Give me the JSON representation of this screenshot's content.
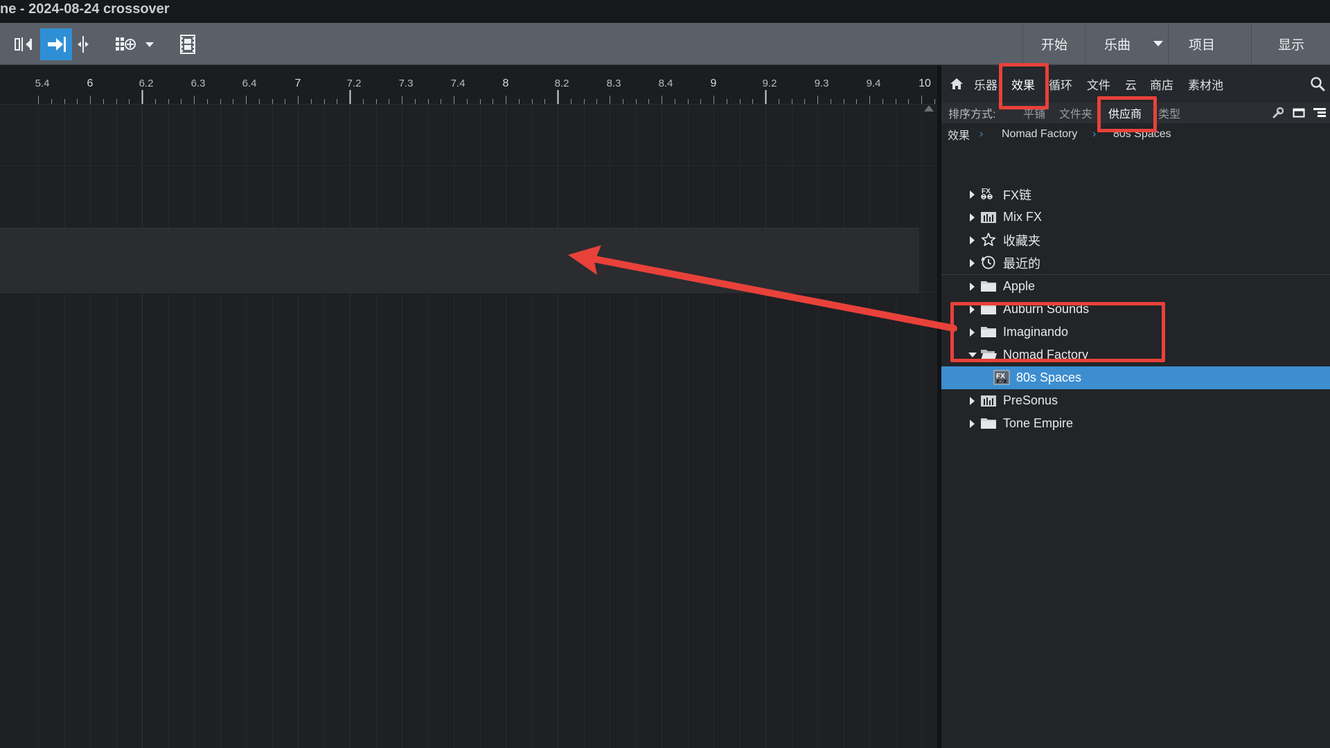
{
  "window": {
    "title": "ne - 2024-08-24 crossover"
  },
  "toolbar": {
    "nav": [
      {
        "label": "开始"
      },
      {
        "label": "乐曲"
      },
      {
        "label": "项目"
      },
      {
        "label": "显示"
      }
    ]
  },
  "ruler": {
    "labels": [
      "5.4",
      "6",
      "6.2",
      "6.3",
      "6.4",
      "7",
      "7.2",
      "7.3",
      "7.4",
      "8",
      "8.2",
      "8.3",
      "8.4",
      "9",
      "9.2",
      "9.3",
      "9.4",
      "10"
    ]
  },
  "browser": {
    "tabs": [
      "乐器",
      "效果",
      "循环",
      "文件",
      "云",
      "商店",
      "素材池"
    ],
    "active_tab": "效果",
    "sort": {
      "label": "排序方式:",
      "options": [
        "平铺",
        "文件夹",
        "供应商",
        "类型"
      ],
      "active": "供应商"
    },
    "breadcrumb": [
      "效果",
      "Nomad Factory",
      "80s Spaces"
    ],
    "tree": [
      {
        "label": "FX链",
        "icon": "fx-chain-icon"
      },
      {
        "label": "Mix FX",
        "icon": "mix-fx-icon"
      },
      {
        "label": "收藏夹",
        "icon": "star-icon"
      },
      {
        "label": "最近的",
        "icon": "clock-icon"
      },
      {
        "label": "Apple",
        "icon": "folder-icon"
      },
      {
        "label": "Auburn Sounds",
        "icon": "folder-icon"
      },
      {
        "label": "Imaginando",
        "icon": "folder-icon"
      },
      {
        "label": "Nomad Factory",
        "icon": "folder-open-icon",
        "expanded": true
      },
      {
        "label": "80s Spaces",
        "icon": "fx-plugin-icon",
        "selected": true,
        "badge": "FX"
      },
      {
        "label": "PreSonus",
        "icon": "mix-fx-icon"
      },
      {
        "label": "Tone Empire",
        "icon": "folder-icon"
      }
    ]
  },
  "colors": {
    "accent": "#3d8ed0",
    "highlight": "#e8413a",
    "toolbar": "#5a6068",
    "panel": "#222428"
  }
}
